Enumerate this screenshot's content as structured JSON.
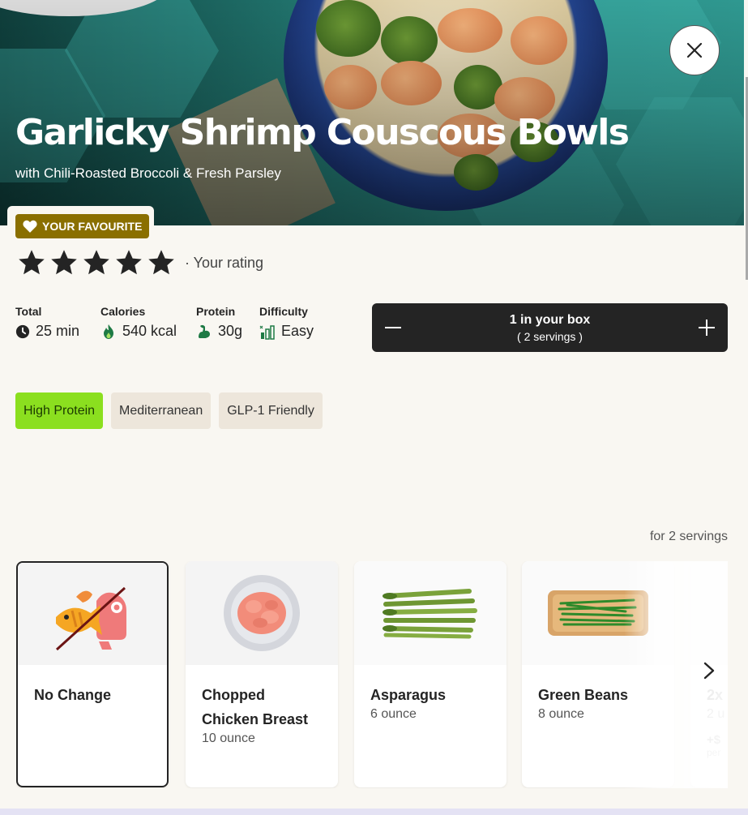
{
  "recipe": {
    "title": "Garlicky Shrimp Couscous Bowls",
    "subtitle": "with Chili-Roasted Broccoli & Fresh Parsley",
    "favourite_label": "YOUR FAVOURITE",
    "rating_stars": 5,
    "rating_label": "· Your rating"
  },
  "stats": [
    {
      "label": "Total",
      "value": "25 min",
      "icon": "clock-icon"
    },
    {
      "label": "Calories",
      "value": "540 kcal",
      "icon": "flame-icon"
    },
    {
      "label": "Protein",
      "value": "30g",
      "icon": "muscle-icon"
    },
    {
      "label": "Difficulty",
      "value": "Easy",
      "icon": "difficulty-icon"
    }
  ],
  "box": {
    "count_label": "1 in your box",
    "servings_label": "( 2 servings )"
  },
  "tags": [
    "High Protein",
    "Mediterranean",
    "GLP-1 Friendly"
  ],
  "customize": {
    "servings_note": "for 2 servings",
    "cards": [
      {
        "name": "No Change",
        "qty": "",
        "icon": "no-change-icon"
      },
      {
        "name": "Chopped Chicken Breast",
        "qty": "10 ounce",
        "icon": "chicken-image"
      },
      {
        "name": "Asparagus",
        "qty": "6 ounce",
        "icon": "asparagus-image"
      },
      {
        "name": "Green Beans",
        "qty": "8 ounce",
        "icon": "green-beans-image"
      },
      {
        "name": "2x",
        "qty": "2 u",
        "extra": "+$",
        "extra2": "per"
      }
    ]
  },
  "colors": {
    "accent_green": "#8bdf1f",
    "favourite_gold": "#8a6f00",
    "dark": "#242424",
    "background": "#f9f7f2"
  }
}
